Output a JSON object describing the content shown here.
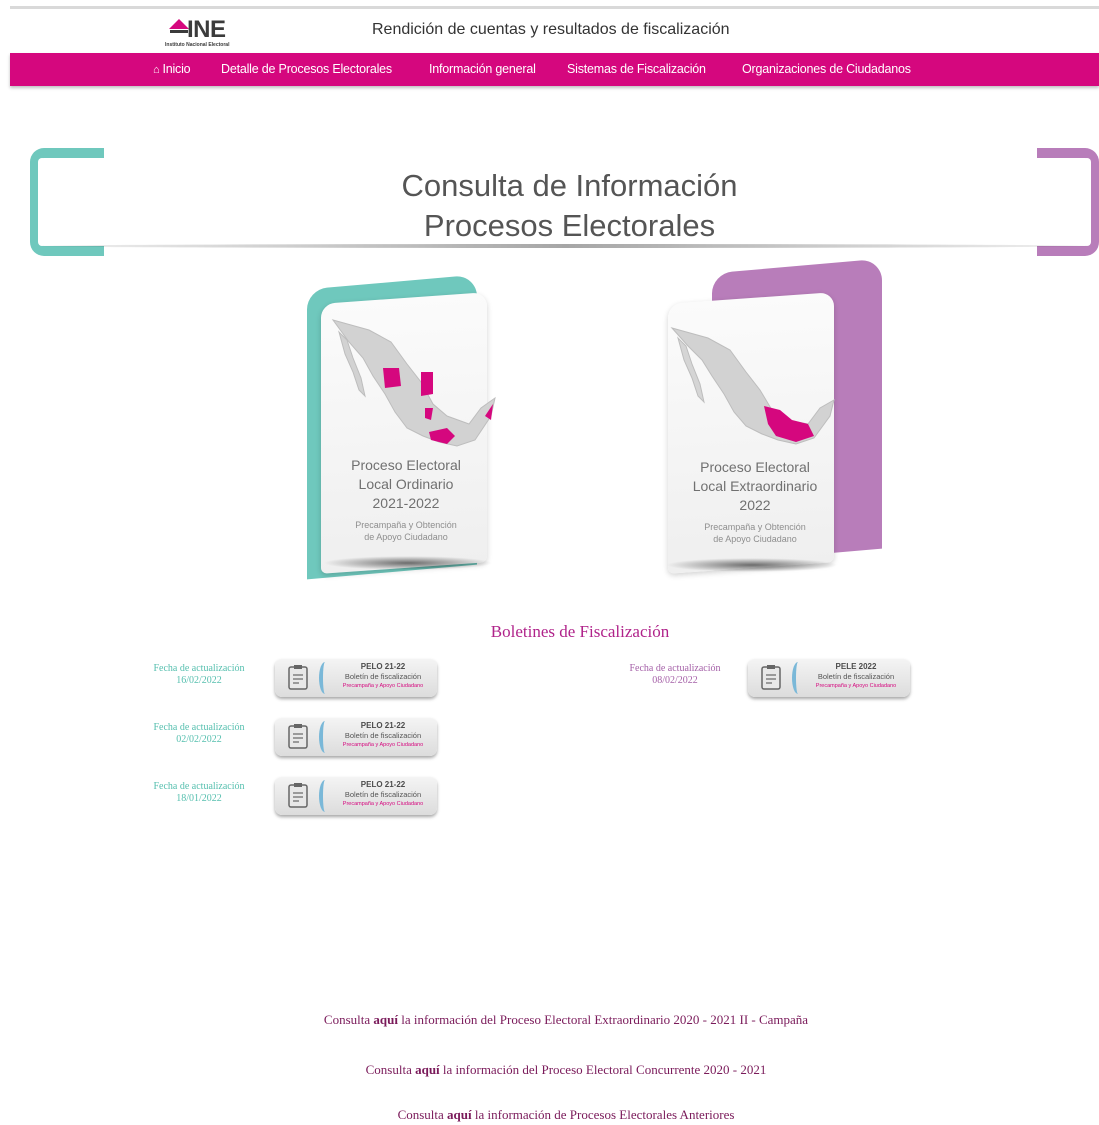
{
  "header": {
    "logo_text": "INE",
    "logo_subtext": "Instituto Nacional Electoral",
    "title": "Rendición de cuentas y resultados de fiscalización"
  },
  "nav": {
    "items": [
      {
        "label": "Inicio",
        "icon": "home-icon"
      },
      {
        "label": "Detalle de Procesos Electorales"
      },
      {
        "label": "Información general"
      },
      {
        "label": "Sistemas de Fiscalización"
      },
      {
        "label": "Organizaciones de Ciudadanos"
      }
    ],
    "background": "#d5077e"
  },
  "banner": {
    "line1": "Consulta de Información",
    "line2": "Procesos Electorales",
    "left_color": "#6fc8bd",
    "right_color": "#b87dba"
  },
  "cards": [
    {
      "title_lines": [
        "Proceso Electoral",
        "Local Ordinario",
        "2021-2022"
      ],
      "subtitle_lines": [
        "Precampaña y Obtención",
        "de Apoyo Ciudadano"
      ],
      "accent": "#6fc8bd"
    },
    {
      "title_lines": [
        "Proceso Electoral",
        "Local Extraordinario",
        "2022"
      ],
      "subtitle_lines": [
        "Precampaña y Obtención",
        "de Apoyo Ciudadano"
      ],
      "accent": "#b87dba"
    }
  ],
  "boletines": {
    "title": "Boletines de Fiscalización",
    "left": [
      {
        "fecha_label": "Fecha de actualización",
        "fecha": "16/02/2022",
        "code": "PELO 21-22",
        "name": "Boletín de fiscalización",
        "tag": "Precampaña y Apoyo Ciudadano"
      },
      {
        "fecha_label": "Fecha de actualización",
        "fecha": "02/02/2022",
        "code": "PELO 21-22",
        "name": "Boletín de fiscalización",
        "tag": "Precampaña y Apoyo Ciudadano"
      },
      {
        "fecha_label": "Fecha de actualización",
        "fecha": "18/01/2022",
        "code": "PELO 21-22",
        "name": "Boletín de fiscalización",
        "tag": "Precampaña y Apoyo Ciudadano"
      }
    ],
    "right": [
      {
        "fecha_label": "Fecha de actualización",
        "fecha": "08/02/2022",
        "code": "PELE 2022",
        "name": "Boletín de fiscalización",
        "tag": "Precampaña y Apoyo Ciudadano"
      }
    ]
  },
  "footer": {
    "links": [
      {
        "pre": "Consulta ",
        "bold": "aquí",
        "post": " la información del Proceso Electoral Extraordinario 2020 - 2021 II - Campaña"
      },
      {
        "pre": "Consulta ",
        "bold": "aquí",
        "post": " la información del Proceso Electoral Concurrente 2020 - 2021"
      },
      {
        "pre": "Consulta ",
        "bold": "aquí",
        "post": " la información de Procesos Electorales Anteriores"
      }
    ]
  }
}
